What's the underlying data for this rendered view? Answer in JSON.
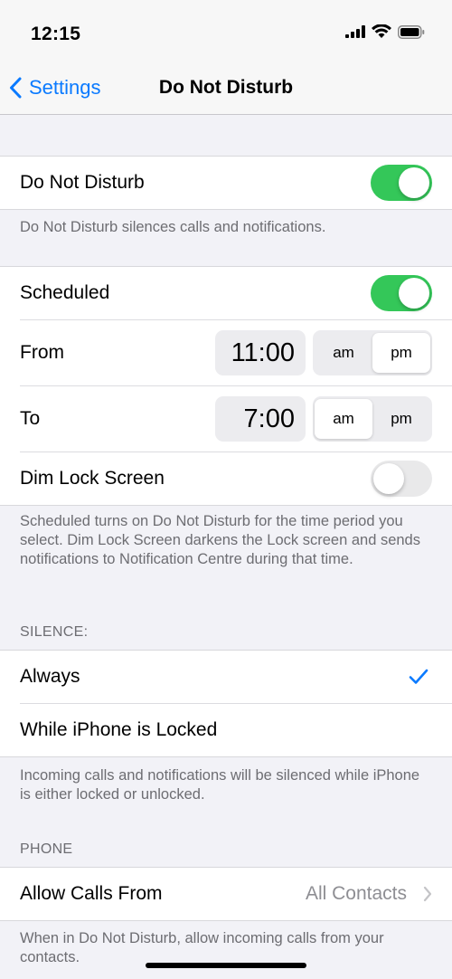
{
  "status": {
    "time": "12:15"
  },
  "nav": {
    "back_label": "Settings",
    "title": "Do Not Disturb"
  },
  "dnd": {
    "label": "Do Not Disturb",
    "enabled": true,
    "footer": "Do Not Disturb silences calls and notifications."
  },
  "schedule": {
    "scheduled_label": "Scheduled",
    "scheduled_enabled": true,
    "from_label": "From",
    "from_time": "11:00",
    "to_label": "To",
    "to_time": "7:00",
    "am": "am",
    "pm": "pm",
    "from_period": "pm",
    "to_period": "am",
    "dim_label": "Dim Lock Screen",
    "dim_enabled": false,
    "footer": "Scheduled turns on Do Not Disturb for the time period you select. Dim Lock Screen darkens the Lock screen and sends notifications to Notification Centre during that time."
  },
  "silence": {
    "header": "SILENCE:",
    "options": [
      {
        "label": "Always",
        "checked": true
      },
      {
        "label": "While iPhone is Locked",
        "checked": false
      }
    ],
    "footer": "Incoming calls and notifications will be silenced while iPhone is either locked or unlocked."
  },
  "phone": {
    "header": "PHONE",
    "allow_label": "Allow Calls From",
    "allow_value": "All Contacts",
    "footer": "When in Do Not Disturb, allow incoming calls from your contacts."
  },
  "colors": {
    "accent": "#0a7aff",
    "toggle_on": "#34c759",
    "secondary_text": "#6d6d72"
  }
}
